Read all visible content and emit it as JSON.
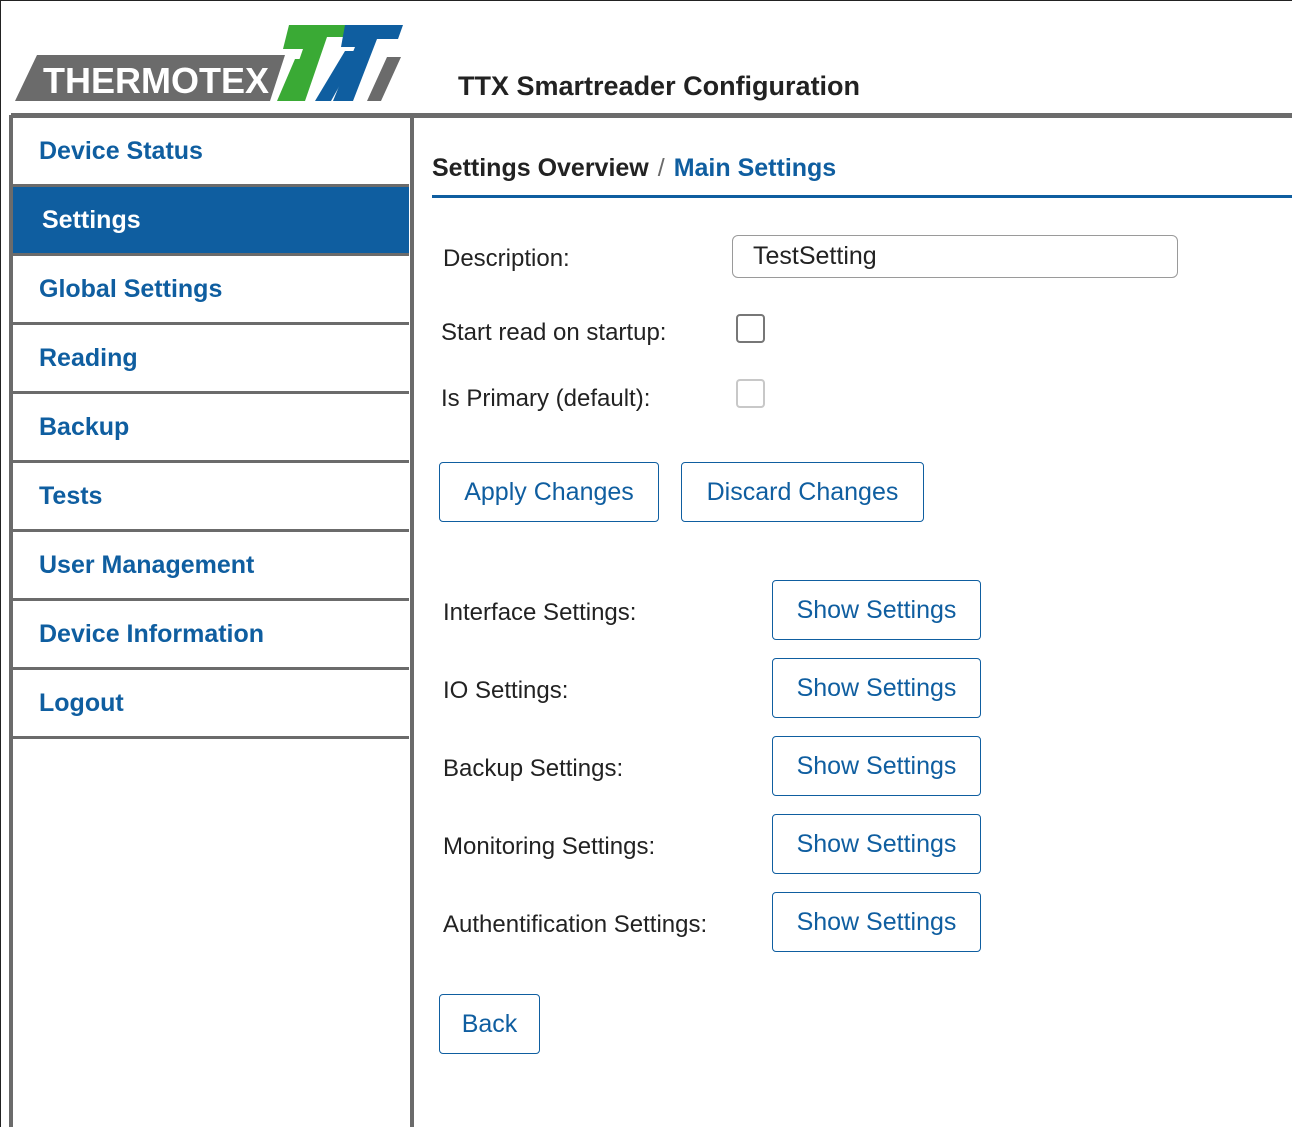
{
  "header": {
    "logo_text": "THERMOTEX",
    "app_title": "TTX Smartreader Configuration"
  },
  "colors": {
    "accent": "#0f5ea0",
    "logo_green": "#3aaa35",
    "logo_blue": "#0f5ea0",
    "logo_gray": "#6b6b6b",
    "border_gray": "#6b6b6b"
  },
  "sidebar": {
    "items": [
      {
        "label": "Device Status",
        "active": false
      },
      {
        "label": "Settings",
        "active": true
      },
      {
        "label": "Global Settings",
        "active": false
      },
      {
        "label": "Reading",
        "active": false
      },
      {
        "label": "Backup",
        "active": false
      },
      {
        "label": "Tests",
        "active": false
      },
      {
        "label": "User Management",
        "active": false
      },
      {
        "label": "Device Information",
        "active": false
      },
      {
        "label": "Logout",
        "active": false
      }
    ]
  },
  "breadcrumb": {
    "parent": "Settings Overview",
    "separator": "/",
    "current": "Main Settings"
  },
  "form": {
    "description_label": "Description:",
    "description_value": "TestSetting",
    "start_read_label": "Start read on startup:",
    "start_read_checked": false,
    "is_primary_label": "Is Primary (default):",
    "is_primary_checked": false,
    "is_primary_disabled": true,
    "apply_label": "Apply Changes",
    "discard_label": "Discard Changes"
  },
  "sections": [
    {
      "label": "Interface Settings:",
      "button": "Show Settings"
    },
    {
      "label": "IO Settings:",
      "button": "Show Settings"
    },
    {
      "label": "Backup Settings:",
      "button": "Show Settings"
    },
    {
      "label": "Monitoring Settings:",
      "button": "Show Settings"
    },
    {
      "label": "Authentification Settings:",
      "button": "Show Settings"
    }
  ],
  "back_label": "Back"
}
